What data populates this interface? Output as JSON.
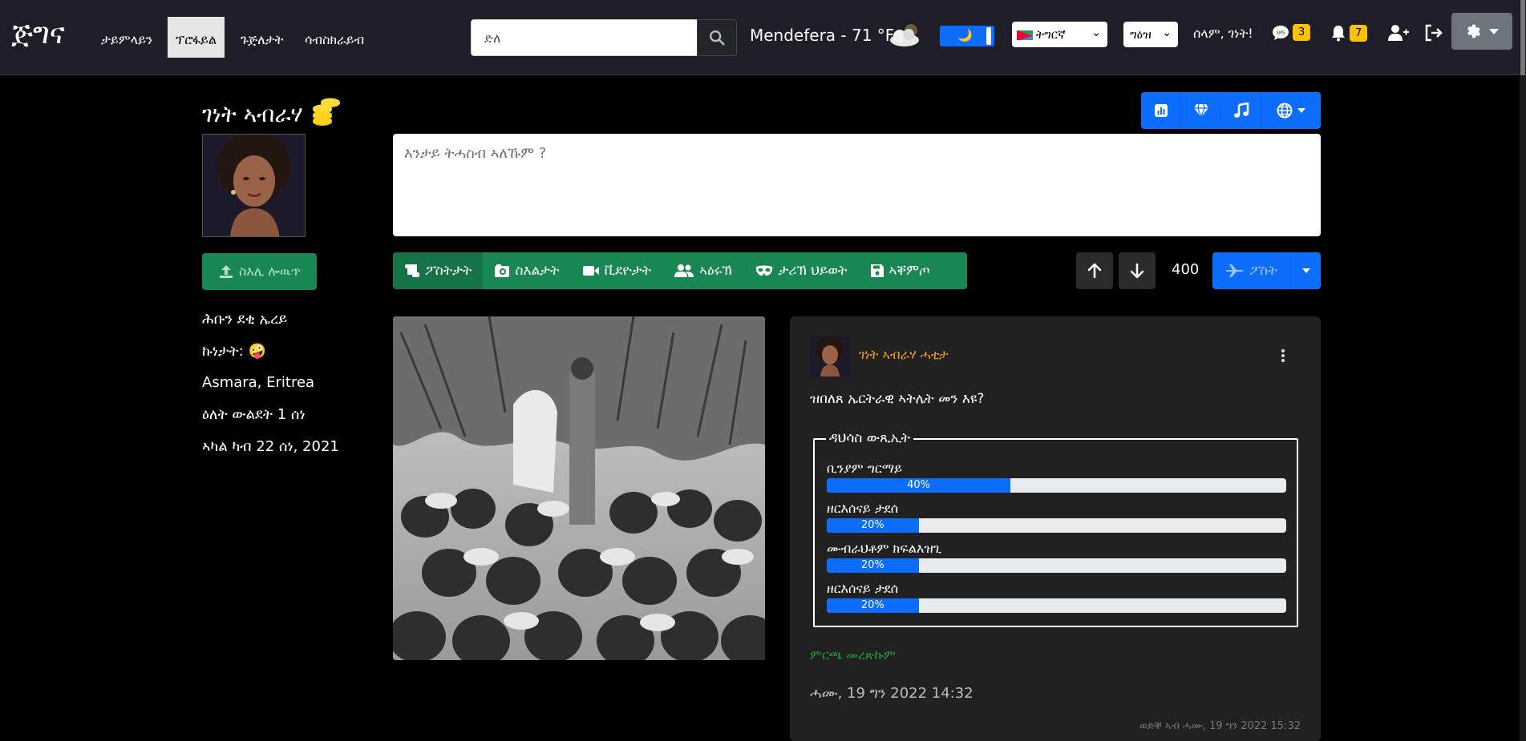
{
  "navbar": {
    "brand": "ጅግና",
    "links": [
      "ታይምላይን",
      "ፕሮፋይል",
      "ጉጅለታት",
      "ሳብስክራይብ"
    ],
    "active_link": "ፕሮፋይል",
    "search_placeholder": "ድለ",
    "weather": "Mendefera - 71 °F",
    "dark_mode_icon": "moon-icon",
    "language": "ትግርኛ",
    "script": "ግዕዝ",
    "greeting": "ሰላም, ገነት!",
    "messages_count": "3",
    "notifications_count": "7",
    "colors": {
      "bg": "#1f1e28",
      "badge": "#ffc107",
      "toggle": "#0d6efd"
    }
  },
  "profile": {
    "name": "ገነት ኣብራሃ",
    "upload_label": "ስእሊ ሎዉጥ",
    "info": [
      "ሕቡን ደቂ ኤረይ",
      "ኩነታት: 🤪",
      "Asmara, Eritrea",
      "ዕለት ውልደት 1 ሰነ",
      "ኣካል ካብ 22 ሰነ, 2021"
    ]
  },
  "composer": {
    "placeholder": "እንታይ ትሓስብ ኣለኹም ?",
    "tabs": [
      "ፖስትታት",
      "ስእልታት",
      "ቪደዮታት",
      "ኣዕሩኽ",
      "ታሪኽ ህይወት",
      "ኣቐምጦ"
    ],
    "count": "400",
    "post_label": "ፖስት"
  },
  "post": {
    "author": "ገነት ኣብራሃ ሓቲታ",
    "question": "ዝበለጸ ኤርትራዊ ኣትሌት መን እዩ?",
    "poll_title": "ዳህሳስ ውጺኢት",
    "options": [
      {
        "label": "ቢንያም ግርማይ",
        "percent": 40,
        "percent_label": "40%"
      },
      {
        "label": "ዘርእሰናይ ታደሰ",
        "percent": 20,
        "percent_label": "20%"
      },
      {
        "label": "ሙብራህቶም ክፍልእዝጊ",
        "percent": 20,
        "percent_label": "20%"
      },
      {
        "label": "ዘርእሰናይ ታደሰ",
        "percent": 20,
        "percent_label": "20%"
      }
    ],
    "show_result": "ምርጫ መረጽኩም",
    "date": "ሓሙ, 19 ግን 2022 14:32",
    "edited": "ወድቐ ኣብ ሓሙ, 19 ግን 2022 15:32",
    "colors": {
      "author": "#f0a020",
      "bar_fill": "#0d6efd",
      "show_result": "#1fa038"
    }
  }
}
